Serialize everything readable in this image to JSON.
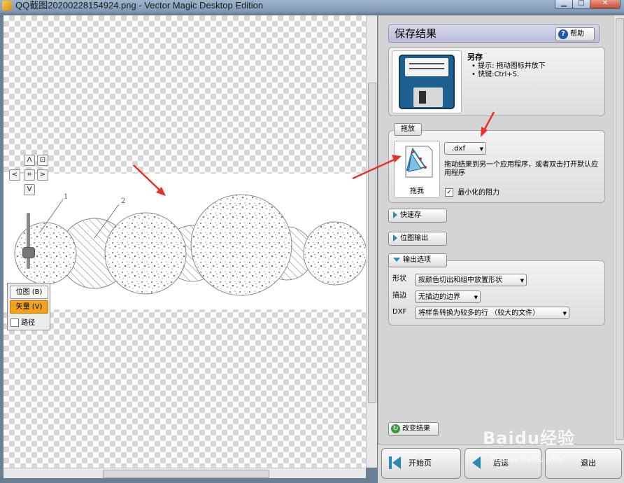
{
  "window": {
    "title": "QQ截图20200228154924.png - Vector Magic Desktop Edition"
  },
  "viewer": {
    "nav": {
      "up": "Λ",
      "left": "<",
      "right": ">",
      "down": "V",
      "fit": "⊡",
      "center": "⌗"
    },
    "drawing_labels": [
      "1",
      "2"
    ],
    "modes": {
      "bitmap": "位图 (B)",
      "vector": "矢量 (V)",
      "path": "路径",
      "path_checked": false
    }
  },
  "panel": {
    "header": {
      "title": "保存结果",
      "help": "帮助"
    },
    "save_as": {
      "title": "另存",
      "tip1": "提示: 拖动图标并放下",
      "tip2": "快键:Ctrl+S."
    },
    "drag": {
      "section_label": "拖放",
      "format": ".dxf",
      "drag_me": "拖我",
      "desc": "拖动结果到另一个应用程序，或者双击打开默认应用程序",
      "minimize_label": "最小化的阻力",
      "minimize_checked": true
    },
    "quick_save": "快速存",
    "bitmap_output": "位图输出",
    "output_options": {
      "label": "输出选项",
      "rows": [
        {
          "label": "形状",
          "value": "按颜色切出和组中放置形状"
        },
        {
          "label": "描边",
          "value": "无描边的边界"
        },
        {
          "label": "DXF",
          "value": "将样条转换为较多的行 （较大的文件）"
        }
      ]
    },
    "change_result": "改变结果"
  },
  "bottom": {
    "start": "开始页",
    "back": "后退",
    "next": "退出"
  },
  "watermark": {
    "brand": "Baidu经验",
    "url": "jingyan.baidu.com"
  },
  "colors": {
    "accent_orange": "#f2a21a",
    "annotation_red": "#e8312a",
    "header_lavender": "#c8cae3"
  }
}
